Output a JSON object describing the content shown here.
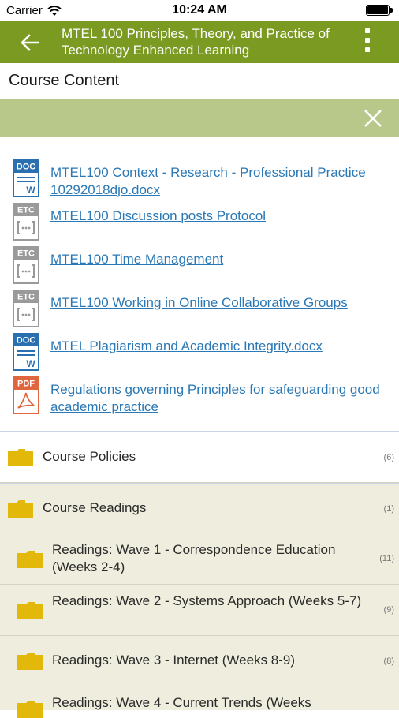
{
  "status_bar": {
    "carrier": "Carrier",
    "time": "10:24 AM"
  },
  "app_bar": {
    "title": "MTEL 100 Principles, Theory, and Practice of Technology Enhanced Learning",
    "back_icon": "arrow-left-icon",
    "menu_icon": "more-vertical-icon"
  },
  "section": {
    "title": "Course Content"
  },
  "files": [
    {
      "type": "DOC",
      "name": "MTEL100 Context - Research - Professional Practice 10292018djo.docx"
    },
    {
      "type": "ETC",
      "name": "MTEL100 Discussion posts  Protocol"
    },
    {
      "type": "ETC",
      "name": "MTEL100 Time Management"
    },
    {
      "type": "ETC",
      "name": "MTEL100 Working in Online Collaborative Groups"
    },
    {
      "type": "DOC",
      "name": "MTEL  Plagiarism and Academic Integrity.docx"
    },
    {
      "type": "PDF",
      "name": "Regulations governing Principles for safeguarding good academic practice"
    }
  ],
  "folders": [
    {
      "name": "Course Policies",
      "count": "(6)"
    },
    {
      "name": "Course Readings",
      "count": "(1)"
    },
    {
      "name": "Readings: Wave 1 - Correspondence Education (Weeks 2-4)",
      "count": "(11)"
    },
    {
      "name": "Readings: Wave 2 - Systems Approach (Weeks 5-7)",
      "count": "(9)"
    },
    {
      "name": "Readings: Wave 3 - Internet (Weeks 8-9)",
      "count": "(8)"
    },
    {
      "name": "Readings: Wave 4 - Current Trends (Weeks",
      "count": ""
    }
  ],
  "colors": {
    "app_bar": "#7b9a22",
    "band": "#b8c78a",
    "link": "#2a78b5",
    "folder": "#e2b80a",
    "folder_row_bg": "#efeede",
    "doc": "#2a6fb0",
    "etc": "#9a9a9a",
    "pdf": "#e0663d"
  }
}
